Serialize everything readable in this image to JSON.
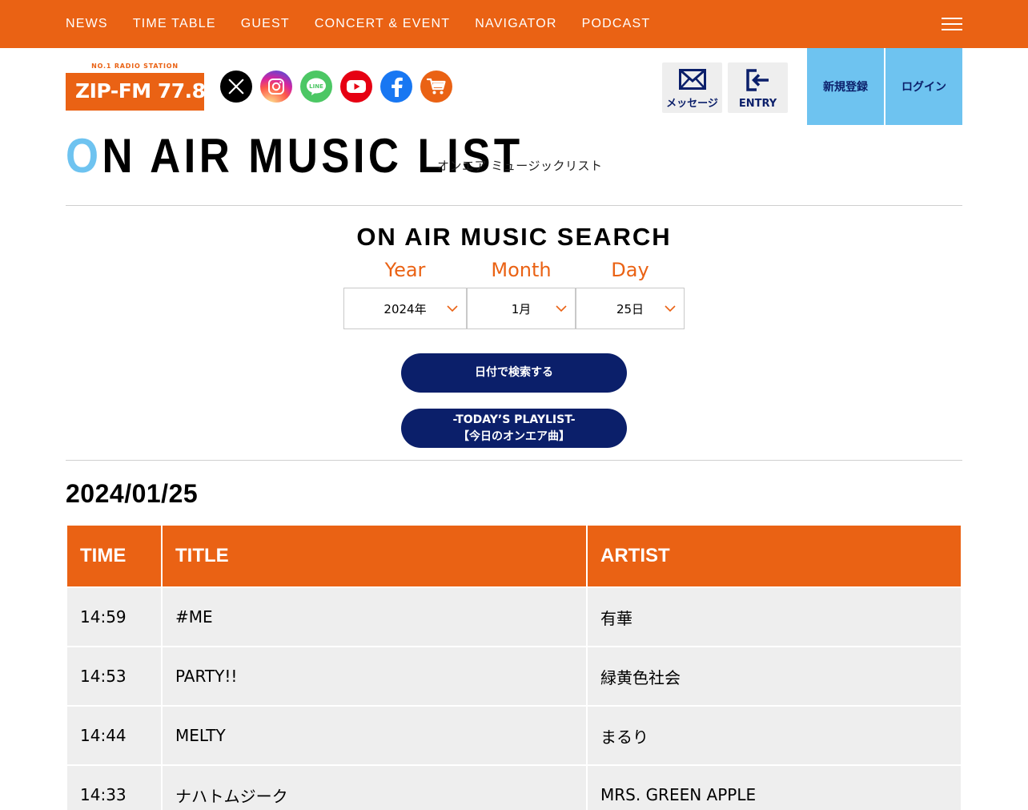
{
  "nav": {
    "items": [
      "NEWS",
      "TIME TABLE",
      "GUEST",
      "CONCERT & EVENT",
      "NAVIGATOR",
      "PODCAST"
    ]
  },
  "header": {
    "logo_tagline": "NO.1 RADIO STATION",
    "logo_text": "ZIP-FM 77.8",
    "social_icons": [
      "x-icon",
      "instagram-icon",
      "line-icon",
      "youtube-icon",
      "facebook-icon",
      "shop-cart-icon"
    ],
    "message_label": "メッセージ",
    "entry_label": "ENTRY",
    "register_label": "新規登録",
    "login_label": "ログイン"
  },
  "page": {
    "title_first": "O",
    "title_rest": "N AIR MUSIC LIST",
    "subtitle": "オンエア ミュージックリスト"
  },
  "search": {
    "title": "ON AIR MUSIC SEARCH",
    "year_label": "Year",
    "month_label": "Month",
    "day_label": "Day",
    "year_value": "2024年",
    "month_value": "1月",
    "day_value": "25日",
    "search_button": "日付で検索する",
    "today_line1": "-TODAY’S PLAYLIST-",
    "today_line2": "【今日のオンエア曲】"
  },
  "result": {
    "date": "2024/01/25",
    "columns": [
      "TIME",
      "TITLE",
      "ARTIST"
    ],
    "rows": [
      {
        "time": "14:59",
        "title": "#ME",
        "artist": "有華"
      },
      {
        "time": "14:53",
        "title": "PARTY!!",
        "artist": "緑黄色社会"
      },
      {
        "time": "14:44",
        "title": "MELTY",
        "artist": "まるり"
      },
      {
        "time": "14:33",
        "title": "ナハトムジーク",
        "artist": "MRS. GREEN APPLE"
      }
    ]
  },
  "colors": {
    "brand_orange": "#ea6214",
    "navy": "#0b1f6a",
    "sky_blue": "#6ec3f0",
    "row_gray": "#eeeeee"
  }
}
